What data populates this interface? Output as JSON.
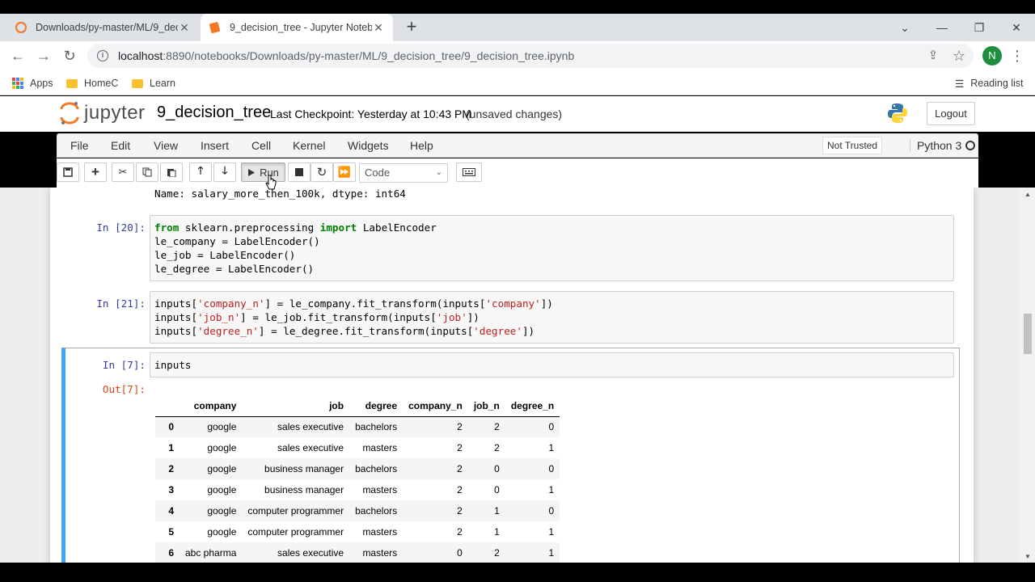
{
  "browser": {
    "tabs": [
      {
        "title": "Downloads/py-master/ML/9_dec",
        "active": false
      },
      {
        "title": "9_decision_tree - Jupyter Notebo",
        "active": true
      }
    ],
    "url_host": "localhost",
    "url_path": ":8890/notebooks/Downloads/py-master/ML/9_decision_tree/9_decision_tree.ipynb",
    "profile_initial": "N",
    "bookmarks": [
      "Apps",
      "HomeC",
      "Learn"
    ],
    "reading_list": "Reading list"
  },
  "jupyter": {
    "logo_text": "jupyter",
    "notebook_name": "9_decision_tree",
    "checkpoint": "Last Checkpoint: Yesterday at 10:43 PM",
    "unsaved": "(unsaved changes)",
    "logout": "Logout",
    "menu": [
      "File",
      "Edit",
      "View",
      "Insert",
      "Cell",
      "Kernel",
      "Widgets",
      "Help"
    ],
    "trusted": "Not Trusted",
    "kernel": "Python 3",
    "run_label": "Run",
    "cell_type": "Code"
  },
  "cells": {
    "prev_output": "Name: salary_more_then_100k, dtype: int64",
    "c20_prompt": "In [20]:",
    "c21_prompt": "In [21]:",
    "c7_prompt": "In [7]:",
    "c7_out_prompt": "Out[7]:",
    "c7_code": "inputs"
  },
  "dataframe": {
    "columns": [
      "",
      "company",
      "job",
      "degree",
      "company_n",
      "job_n",
      "degree_n"
    ],
    "rows": [
      [
        "0",
        "google",
        "sales executive",
        "bachelors",
        "2",
        "2",
        "0"
      ],
      [
        "1",
        "google",
        "sales executive",
        "masters",
        "2",
        "2",
        "1"
      ],
      [
        "2",
        "google",
        "business manager",
        "bachelors",
        "2",
        "0",
        "0"
      ],
      [
        "3",
        "google",
        "business manager",
        "masters",
        "2",
        "0",
        "1"
      ],
      [
        "4",
        "google",
        "computer programmer",
        "bachelors",
        "2",
        "1",
        "0"
      ],
      [
        "5",
        "google",
        "computer programmer",
        "masters",
        "2",
        "1",
        "1"
      ],
      [
        "6",
        "abc pharma",
        "sales executive",
        "masters",
        "0",
        "2",
        "1"
      ]
    ]
  },
  "colors": {
    "accent_selected": "#42a5f5",
    "prompt_in": "#303f9f",
    "prompt_out": "#d84315",
    "keyword": "#008000",
    "string": "#ba2121"
  }
}
